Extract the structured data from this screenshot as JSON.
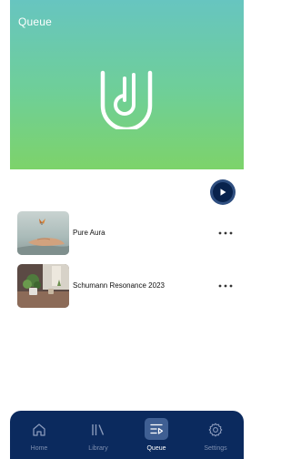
{
  "header": {
    "title": "Queue",
    "logo_icon": "app-logo-icon"
  },
  "player": {
    "play_icon": "play-icon"
  },
  "queue": {
    "items": [
      {
        "title": "Pure Aura",
        "thumb_icon": "hand-butterfly-thumbnail",
        "menu_icon": "more-dots-icon"
      },
      {
        "title": "Schumann Resonance 2023",
        "thumb_icon": "plant-room-thumbnail",
        "menu_icon": "more-dots-icon"
      }
    ]
  },
  "tabs": [
    {
      "label": "Home",
      "icon": "home-icon",
      "active": false
    },
    {
      "label": "Library",
      "icon": "library-icon",
      "active": false
    },
    {
      "label": "Queue",
      "icon": "queue-icon",
      "active": true
    },
    {
      "label": "Settings",
      "icon": "gear-icon",
      "active": false
    }
  ],
  "colors": {
    "hero_gradient_top": "#67c5c0",
    "hero_gradient_bottom": "#7dd36a",
    "tabbar": "#0b2a5e",
    "tab_active_bg": "#3f5f93",
    "play_button": "#08224c"
  }
}
